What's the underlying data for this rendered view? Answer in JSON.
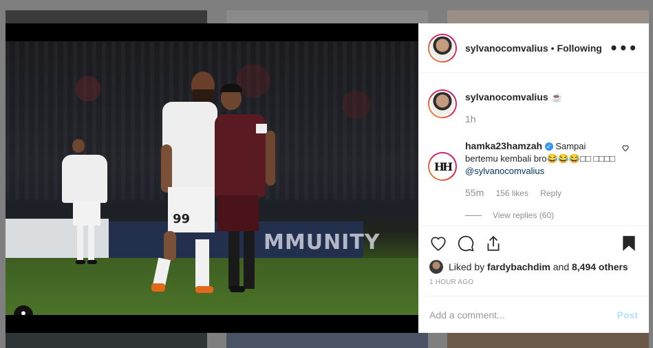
{
  "header": {
    "username": "sylvanocomvalius",
    "separator": "•",
    "follow_status": "Following",
    "more_label": "•••"
  },
  "caption": {
    "username": "sylvanocomvalius",
    "text": "☕",
    "time": "1h"
  },
  "comment": {
    "username": "hamka23hamzah",
    "verified_mark": "✓",
    "text": "Sampai bertemu kembali bro😂😂😂□□ □□□□",
    "mention": "@sylvanocomvalius",
    "time": "55m",
    "likes": "156 likes",
    "reply_label": "Reply",
    "view_replies": "View replies (60)",
    "avatar_logo": "HH"
  },
  "actions": {
    "liked_by_prefix": "Liked by",
    "liked_by_user": "fardybachdim",
    "liked_by_and": "and",
    "liked_by_others": "8,494 others",
    "timestamp": "1 HOUR AGO"
  },
  "add_comment": {
    "placeholder": "Add a comment...",
    "post_label": "Post"
  },
  "photo": {
    "player_number": "99",
    "banner_text": "MMUNITY"
  },
  "colors": {
    "accent_blue": "#3897f0",
    "post_disabled": "#b2dffc",
    "text": "#262626",
    "meta": "#8e8e8e"
  },
  "icons": [
    "more-icon",
    "user-tag-icon",
    "heart-icon",
    "comment-icon",
    "share-icon",
    "bookmark-icon",
    "verified-icon",
    "coffee-emoji"
  ]
}
